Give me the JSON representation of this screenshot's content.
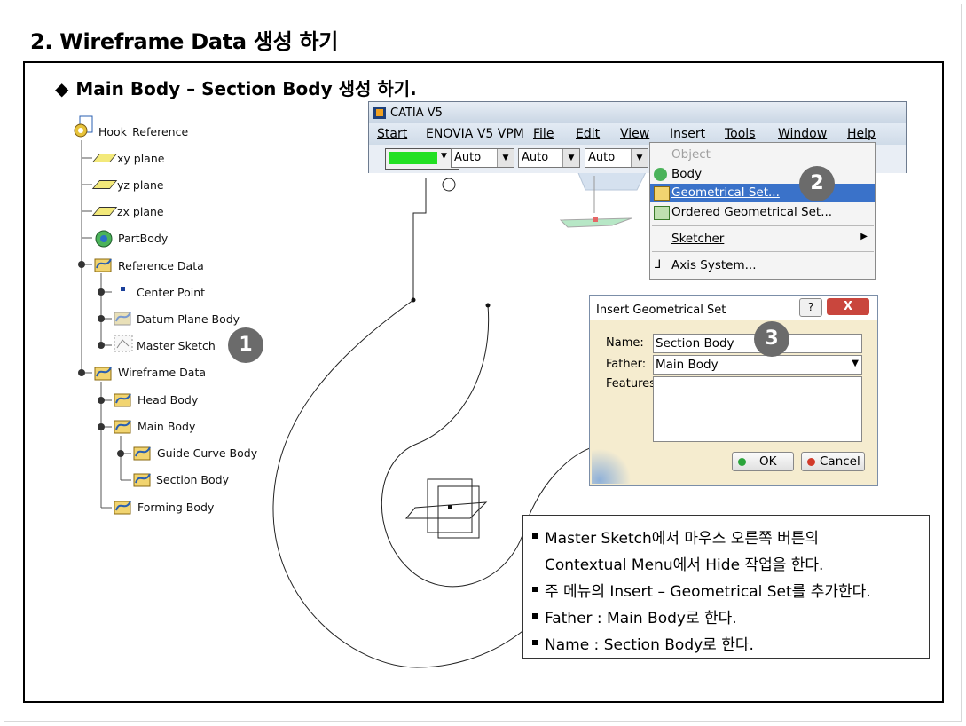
{
  "slide": {
    "title": "2. Wireframe Data 생성 하기",
    "subtitle_bullet": "◆",
    "subtitle": "Main Body – Section Body 생성 하기."
  },
  "tree": {
    "root": "Hook_Reference",
    "items": [
      {
        "label": "xy plane"
      },
      {
        "label": "yz plane"
      },
      {
        "label": "zx plane"
      },
      {
        "label": "PartBody"
      },
      {
        "label": "Reference Data"
      },
      {
        "label": "Center Point"
      },
      {
        "label": "Datum Plane Body"
      },
      {
        "label": "Master Sketch"
      },
      {
        "label": "Wireframe Data"
      },
      {
        "label": "Head Body"
      },
      {
        "label": "Main Body"
      },
      {
        "label": "Guide Curve Body"
      },
      {
        "label": "Section Body"
      },
      {
        "label": "Forming Body"
      }
    ]
  },
  "badges": [
    "1",
    "2",
    "3"
  ],
  "catia": {
    "title": "CATIA V5",
    "menu": [
      "Start",
      "ENOVIA V5 VPM",
      "File",
      "Edit",
      "View",
      "Insert",
      "Tools",
      "Window",
      "Help"
    ],
    "toolbar": {
      "color": "#22e022",
      "combo1": "Auto",
      "combo2": "Auto",
      "combo3": "Auto"
    }
  },
  "insert_menu": {
    "items": [
      {
        "label": "Object",
        "state": "disabled"
      },
      {
        "label": "Body",
        "state": "normal"
      },
      {
        "label": "Geometrical Set...",
        "state": "selected"
      },
      {
        "label": "Ordered Geometrical Set...",
        "state": "normal"
      },
      {
        "label": "Sketcher",
        "state": "submenu"
      },
      {
        "label": "Axis System...",
        "state": "normal"
      }
    ]
  },
  "dialog": {
    "title": "Insert Geometrical Set",
    "help": "?",
    "close": "X",
    "name_label": "Name:",
    "name_value": "Section Body",
    "father_label": "Father:",
    "father_value": "Main Body",
    "features_label": "Features:",
    "ok": "OK",
    "cancel": "Cancel"
  },
  "notes": [
    "Master Sketch에서 마우스 오른쪽 버튼의",
    "Contextual Menu에서 Hide 작업을 한다.",
    "주 메뉴의 Insert – Geometrical Set를 추가한다.",
    "Father : Main Body로 한다.",
    "Name : Section Body로 한다."
  ],
  "colors": {
    "selection": "#3a72c9",
    "badge": "#6b6b6b",
    "dialog_bg": "#f5eccf"
  }
}
